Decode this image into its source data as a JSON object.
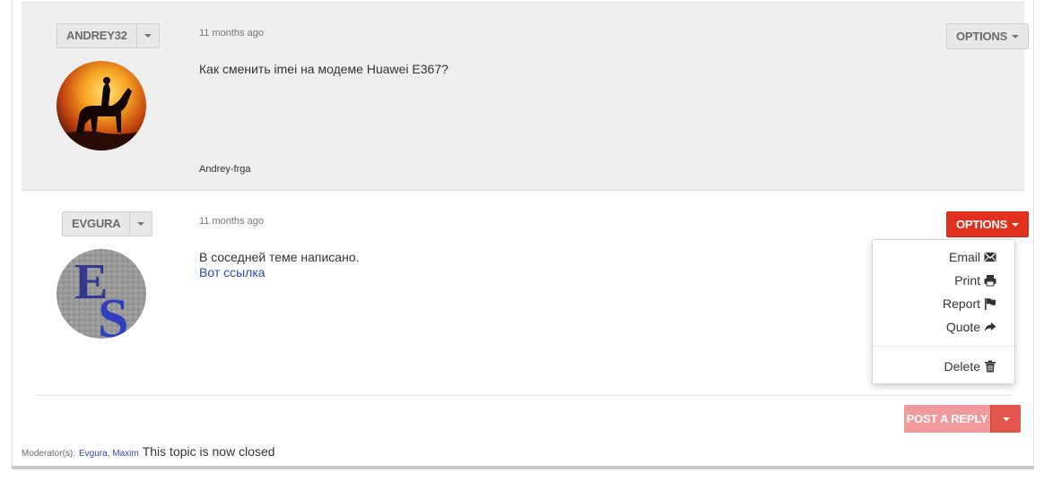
{
  "posts": [
    {
      "username": "ANDREY32",
      "time": "11 months ago",
      "message": "Как сменить imei на модеме Huawei E367?",
      "signature": "Andrey-frga",
      "options_label": "OPTIONS",
      "options_state": "closed",
      "avatar": "horse-rider-sunset-avatar"
    },
    {
      "username": "EVGURA",
      "time": "11 months ago",
      "message": "В соседней теме написано.",
      "link": "Вот ссылка",
      "options_label": "OPTIONS",
      "options_state": "open",
      "avatar": "letters-es-avatar"
    }
  ],
  "dropdown": {
    "items": [
      {
        "label": "Email",
        "icon": "envelope-icon"
      },
      {
        "label": "Print",
        "icon": "printer-icon"
      },
      {
        "label": "Report",
        "icon": "flag-icon"
      },
      {
        "label": "Quote",
        "icon": "share-arrow-icon"
      },
      {
        "label": "Delete",
        "icon": "trash-icon"
      }
    ]
  },
  "reply": {
    "label": "POST A REPLY"
  },
  "footer": {
    "moderators_label": "Moderator(s):",
    "moderators": [
      "Evgura",
      "Maxim"
    ],
    "status": "This topic is now closed"
  },
  "colors": {
    "accent_red": "#e0301e",
    "reply_pink": "#f0999a",
    "link_blue": "#2a4cb3"
  }
}
